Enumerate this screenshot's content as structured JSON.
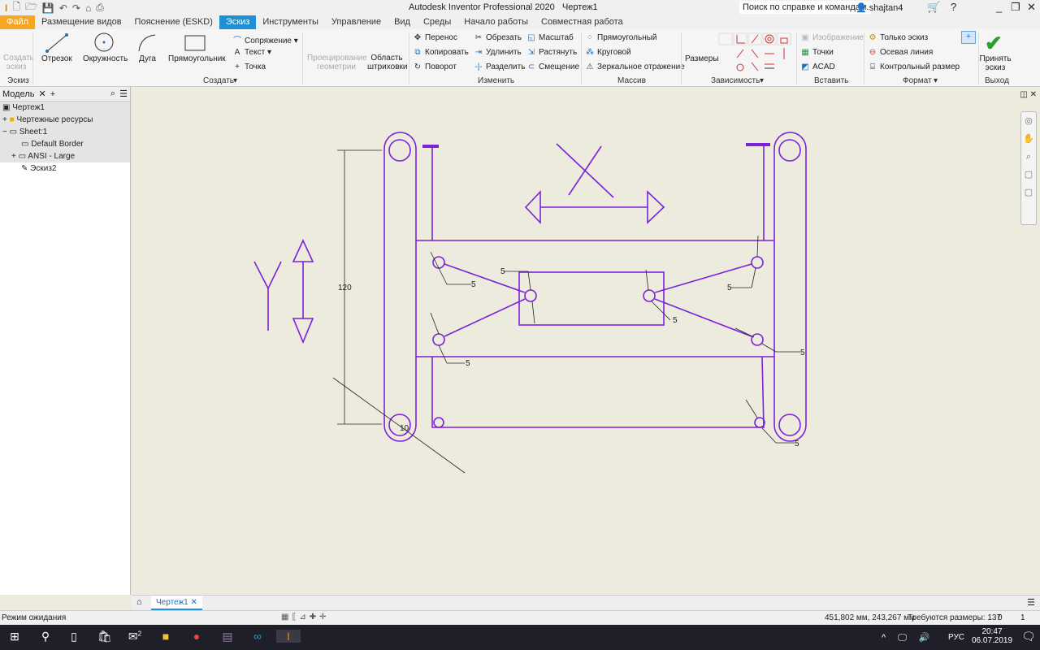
{
  "app": {
    "title": "Autodesk Inventor Professional 2020",
    "document": "Чертеж1",
    "search_placeholder": "Поиск по справке и командам.",
    "user": "shajtan4"
  },
  "tabs": [
    "Файл",
    "Размещение видов",
    "Пояснение (ESKD)",
    "Эскиз",
    "Инструменты",
    "Управление",
    "Вид",
    "Среды",
    "Начало работы",
    "Совместная работа"
  ],
  "active_tab": "Эскиз",
  "ribbon": {
    "sketch": {
      "create": "Создать эскиз",
      "group": "Эскиз"
    },
    "create": {
      "line": "Отрезок",
      "circle": "Окружность",
      "arc": "Дуга",
      "rect": "Прямоугольник",
      "fillet": "Сопряжение",
      "text": "Текст",
      "point": "Точка",
      "project": "Проецирование геометрии",
      "hatch": "Область штриховки",
      "group": "Создать"
    },
    "modify": {
      "move": "Перенос",
      "copy": "Копировать",
      "rotate": "Поворот",
      "trim": "Обрезать",
      "extend": "Удлинить",
      "split": "Разделить",
      "scale": "Масштаб",
      "stretch": "Растянуть",
      "offset": "Смещение",
      "group": "Изменить"
    },
    "pattern": {
      "rect": "Прямоугольный",
      "circ": "Круговой",
      "mirror": "Зеркальное отражение",
      "group": "Массив"
    },
    "constrain": {
      "dim": "Размеры",
      "group": "Зависимость"
    },
    "insert": {
      "image": "Изображение",
      "points": "Точки",
      "acad": "ACAD",
      "group": "Вставить"
    },
    "format": {
      "sketch_only": "Только эскиз",
      "centerline": "Осевая линия",
      "driven": "Контрольный размер",
      "group": "Формат"
    },
    "exit": {
      "finish": "Принять эскиз",
      "group": "Выход"
    }
  },
  "browser": {
    "tab": "Модель",
    "nodes": [
      "Чертеж1",
      "Чертежные ресурсы",
      "Sheet:1",
      "Default Border",
      "ANSI - Large",
      "Эскиз2"
    ]
  },
  "drawing": {
    "dim_vertical": "120",
    "dim_diameter": "10",
    "leader": "5",
    "color": "#7b22d9"
  },
  "doc_tab": "Чертеж1",
  "status": {
    "mode": "Режим ожидания",
    "coords": "451,802 мм, 243,267 мм",
    "required": "Требуются размеры: 137",
    "a": "0",
    "b": "1"
  },
  "taskbar": {
    "lang": "РУС",
    "time": "20:47",
    "date": "06.07.2019",
    "mail_badge": "2"
  }
}
